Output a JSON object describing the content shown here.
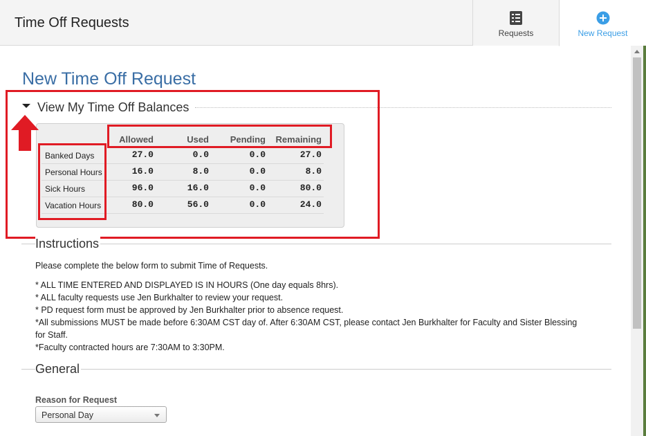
{
  "header": {
    "title": "Time Off Requests",
    "tabs": [
      {
        "label": "Requests",
        "icon": "checklist-icon"
      },
      {
        "label": "New Request",
        "icon": "plus-circle-icon"
      }
    ],
    "accent_color": "#3b9ee6"
  },
  "page": {
    "heading": "New Time Off Request"
  },
  "balances": {
    "toggle_label": "View My Time Off Balances",
    "columns": [
      "Allowed",
      "Used",
      "Pending",
      "Remaining"
    ],
    "rows": [
      {
        "label": "Banked Days",
        "values": [
          "27.0",
          "0.0",
          "0.0",
          "27.0"
        ]
      },
      {
        "label": "Personal Hours",
        "values": [
          "16.0",
          "8.0",
          "0.0",
          "8.0"
        ]
      },
      {
        "label": "Sick Hours",
        "values": [
          "96.0",
          "16.0",
          "0.0",
          "80.0"
        ]
      },
      {
        "label": "Vacation Hours",
        "values": [
          "80.0",
          "56.0",
          "0.0",
          "24.0"
        ]
      }
    ]
  },
  "annotation_color": "#e01b24",
  "instructions": {
    "title": "Instructions",
    "intro": "Please complete the below form to submit Time of Requests.",
    "lines": [
      "* ALL TIME ENTERED AND DISPLAYED IS IN HOURS (One day equals 8hrs).",
      "* ALL faculty requests use Jen Burkhalter to review your request.",
      "* PD request form must be approved by Jen Burkhalter prior to absence request.",
      "*All submissions MUST be made before 6:30AM CST day of. After 6:30AM CST, please contact Jen Burkhalter for Faculty and Sister Blessing for Staff.",
      "*Faculty contracted hours are 7:30AM to 3:30PM."
    ]
  },
  "general": {
    "title": "General",
    "reason_label": "Reason for Request",
    "reason_value": "Personal Day"
  }
}
